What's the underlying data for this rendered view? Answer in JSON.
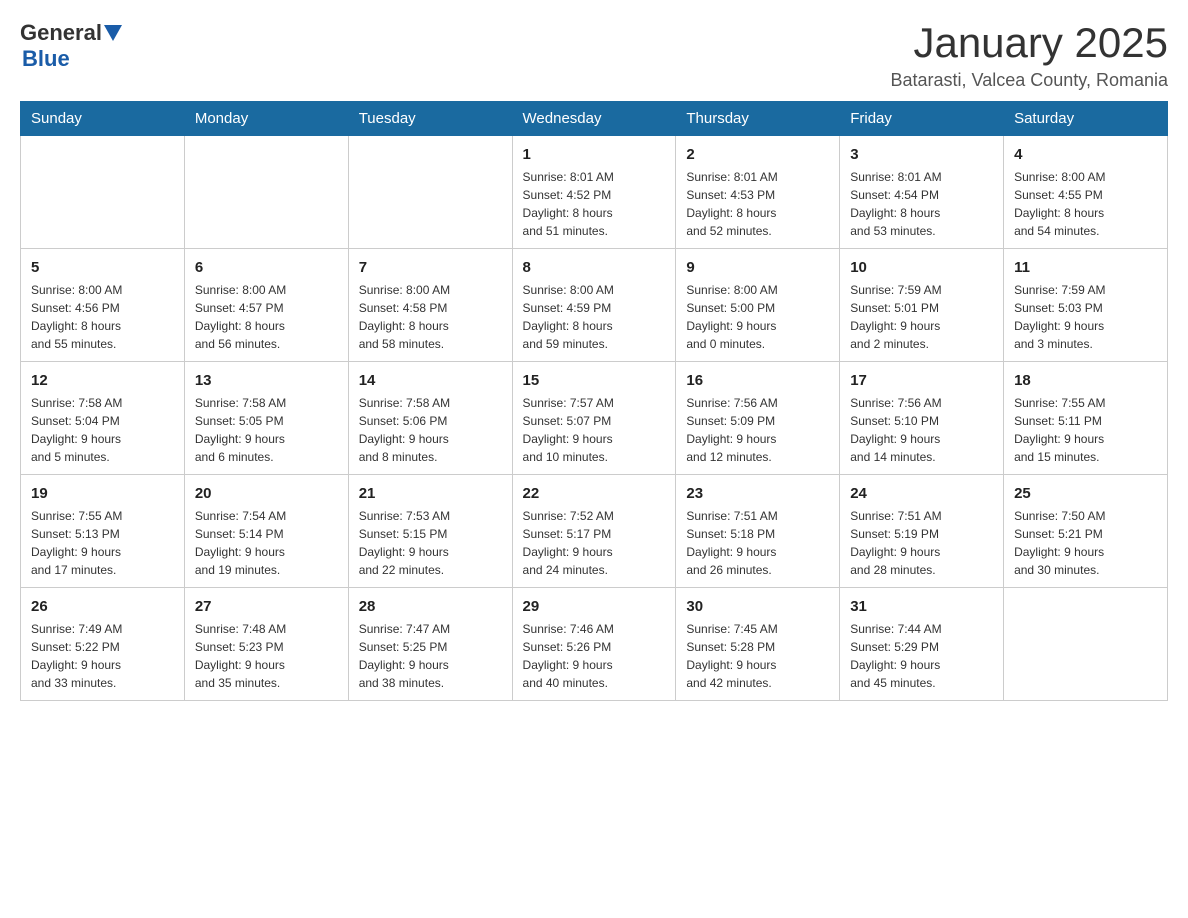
{
  "header": {
    "logo_general": "General",
    "logo_blue": "Blue",
    "month_title": "January 2025",
    "location": "Batarasti, Valcea County, Romania"
  },
  "days_of_week": [
    "Sunday",
    "Monday",
    "Tuesday",
    "Wednesday",
    "Thursday",
    "Friday",
    "Saturday"
  ],
  "weeks": [
    [
      {
        "day": "",
        "info": ""
      },
      {
        "day": "",
        "info": ""
      },
      {
        "day": "",
        "info": ""
      },
      {
        "day": "1",
        "info": "Sunrise: 8:01 AM\nSunset: 4:52 PM\nDaylight: 8 hours\nand 51 minutes."
      },
      {
        "day": "2",
        "info": "Sunrise: 8:01 AM\nSunset: 4:53 PM\nDaylight: 8 hours\nand 52 minutes."
      },
      {
        "day": "3",
        "info": "Sunrise: 8:01 AM\nSunset: 4:54 PM\nDaylight: 8 hours\nand 53 minutes."
      },
      {
        "day": "4",
        "info": "Sunrise: 8:00 AM\nSunset: 4:55 PM\nDaylight: 8 hours\nand 54 minutes."
      }
    ],
    [
      {
        "day": "5",
        "info": "Sunrise: 8:00 AM\nSunset: 4:56 PM\nDaylight: 8 hours\nand 55 minutes."
      },
      {
        "day": "6",
        "info": "Sunrise: 8:00 AM\nSunset: 4:57 PM\nDaylight: 8 hours\nand 56 minutes."
      },
      {
        "day": "7",
        "info": "Sunrise: 8:00 AM\nSunset: 4:58 PM\nDaylight: 8 hours\nand 58 minutes."
      },
      {
        "day": "8",
        "info": "Sunrise: 8:00 AM\nSunset: 4:59 PM\nDaylight: 8 hours\nand 59 minutes."
      },
      {
        "day": "9",
        "info": "Sunrise: 8:00 AM\nSunset: 5:00 PM\nDaylight: 9 hours\nand 0 minutes."
      },
      {
        "day": "10",
        "info": "Sunrise: 7:59 AM\nSunset: 5:01 PM\nDaylight: 9 hours\nand 2 minutes."
      },
      {
        "day": "11",
        "info": "Sunrise: 7:59 AM\nSunset: 5:03 PM\nDaylight: 9 hours\nand 3 minutes."
      }
    ],
    [
      {
        "day": "12",
        "info": "Sunrise: 7:58 AM\nSunset: 5:04 PM\nDaylight: 9 hours\nand 5 minutes."
      },
      {
        "day": "13",
        "info": "Sunrise: 7:58 AM\nSunset: 5:05 PM\nDaylight: 9 hours\nand 6 minutes."
      },
      {
        "day": "14",
        "info": "Sunrise: 7:58 AM\nSunset: 5:06 PM\nDaylight: 9 hours\nand 8 minutes."
      },
      {
        "day": "15",
        "info": "Sunrise: 7:57 AM\nSunset: 5:07 PM\nDaylight: 9 hours\nand 10 minutes."
      },
      {
        "day": "16",
        "info": "Sunrise: 7:56 AM\nSunset: 5:09 PM\nDaylight: 9 hours\nand 12 minutes."
      },
      {
        "day": "17",
        "info": "Sunrise: 7:56 AM\nSunset: 5:10 PM\nDaylight: 9 hours\nand 14 minutes."
      },
      {
        "day": "18",
        "info": "Sunrise: 7:55 AM\nSunset: 5:11 PM\nDaylight: 9 hours\nand 15 minutes."
      }
    ],
    [
      {
        "day": "19",
        "info": "Sunrise: 7:55 AM\nSunset: 5:13 PM\nDaylight: 9 hours\nand 17 minutes."
      },
      {
        "day": "20",
        "info": "Sunrise: 7:54 AM\nSunset: 5:14 PM\nDaylight: 9 hours\nand 19 minutes."
      },
      {
        "day": "21",
        "info": "Sunrise: 7:53 AM\nSunset: 5:15 PM\nDaylight: 9 hours\nand 22 minutes."
      },
      {
        "day": "22",
        "info": "Sunrise: 7:52 AM\nSunset: 5:17 PM\nDaylight: 9 hours\nand 24 minutes."
      },
      {
        "day": "23",
        "info": "Sunrise: 7:51 AM\nSunset: 5:18 PM\nDaylight: 9 hours\nand 26 minutes."
      },
      {
        "day": "24",
        "info": "Sunrise: 7:51 AM\nSunset: 5:19 PM\nDaylight: 9 hours\nand 28 minutes."
      },
      {
        "day": "25",
        "info": "Sunrise: 7:50 AM\nSunset: 5:21 PM\nDaylight: 9 hours\nand 30 minutes."
      }
    ],
    [
      {
        "day": "26",
        "info": "Sunrise: 7:49 AM\nSunset: 5:22 PM\nDaylight: 9 hours\nand 33 minutes."
      },
      {
        "day": "27",
        "info": "Sunrise: 7:48 AM\nSunset: 5:23 PM\nDaylight: 9 hours\nand 35 minutes."
      },
      {
        "day": "28",
        "info": "Sunrise: 7:47 AM\nSunset: 5:25 PM\nDaylight: 9 hours\nand 38 minutes."
      },
      {
        "day": "29",
        "info": "Sunrise: 7:46 AM\nSunset: 5:26 PM\nDaylight: 9 hours\nand 40 minutes."
      },
      {
        "day": "30",
        "info": "Sunrise: 7:45 AM\nSunset: 5:28 PM\nDaylight: 9 hours\nand 42 minutes."
      },
      {
        "day": "31",
        "info": "Sunrise: 7:44 AM\nSunset: 5:29 PM\nDaylight: 9 hours\nand 45 minutes."
      },
      {
        "day": "",
        "info": ""
      }
    ]
  ]
}
